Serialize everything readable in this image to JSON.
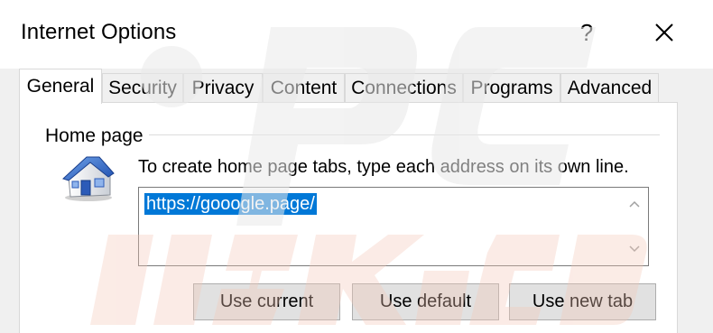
{
  "window": {
    "title": "Internet Options",
    "help_label": "?",
    "close_icon": "close-icon"
  },
  "tabs": [
    {
      "label": "General",
      "active": true
    },
    {
      "label": "Security",
      "active": false
    },
    {
      "label": "Privacy",
      "active": false
    },
    {
      "label": "Content",
      "active": false
    },
    {
      "label": "Connections",
      "active": false
    },
    {
      "label": "Programs",
      "active": false
    },
    {
      "label": "Advanced",
      "active": false
    }
  ],
  "home_page": {
    "group_label": "Home page",
    "icon": "house-icon",
    "instructions": "To create home page tabs, type each address on its own line.",
    "address_value": "https://gooogle.page/",
    "buttons": {
      "use_current": "Use current",
      "use_default": "Use default",
      "use_new_tab": "Use new tab"
    }
  },
  "colors": {
    "selection": "#0078d7",
    "client_bg": "#f0f0f0",
    "button_bg": "#e1e1e1"
  }
}
